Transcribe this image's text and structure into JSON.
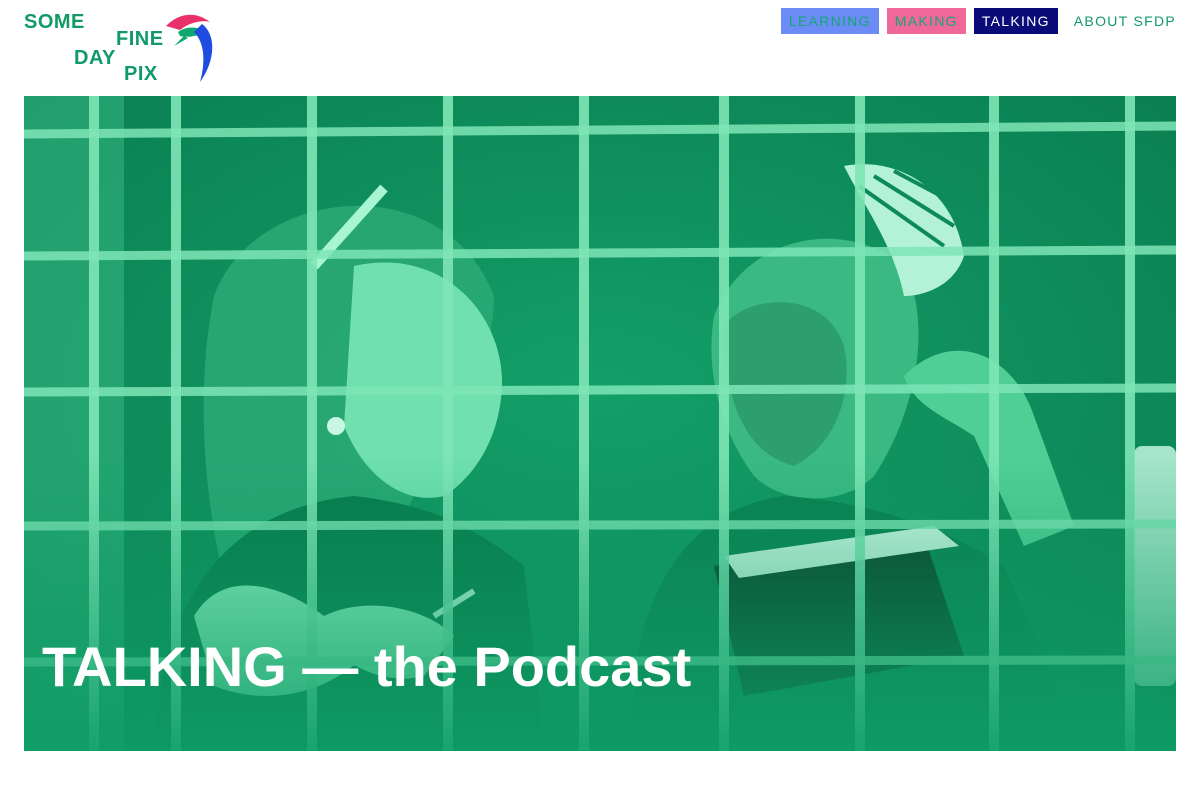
{
  "brand": {
    "words": [
      "SOME",
      "FINE",
      "DAY",
      "PIX"
    ],
    "text_color": "#0f9a68",
    "bird_colors": [
      "#e8306a",
      "#1e4de0",
      "#10a870"
    ]
  },
  "nav": {
    "items": [
      {
        "label": "LEARNING",
        "bg": "#6b8cf5"
      },
      {
        "label": "MAKING",
        "bg": "#f0679a"
      },
      {
        "label": "TALKING",
        "bg": "#0a0a78"
      },
      {
        "label": "ABOUT SFDP"
      }
    ],
    "active": "TALKING"
  },
  "hero": {
    "title": "TALKING — the Podcast",
    "tint_color": "#0f9d66"
  }
}
